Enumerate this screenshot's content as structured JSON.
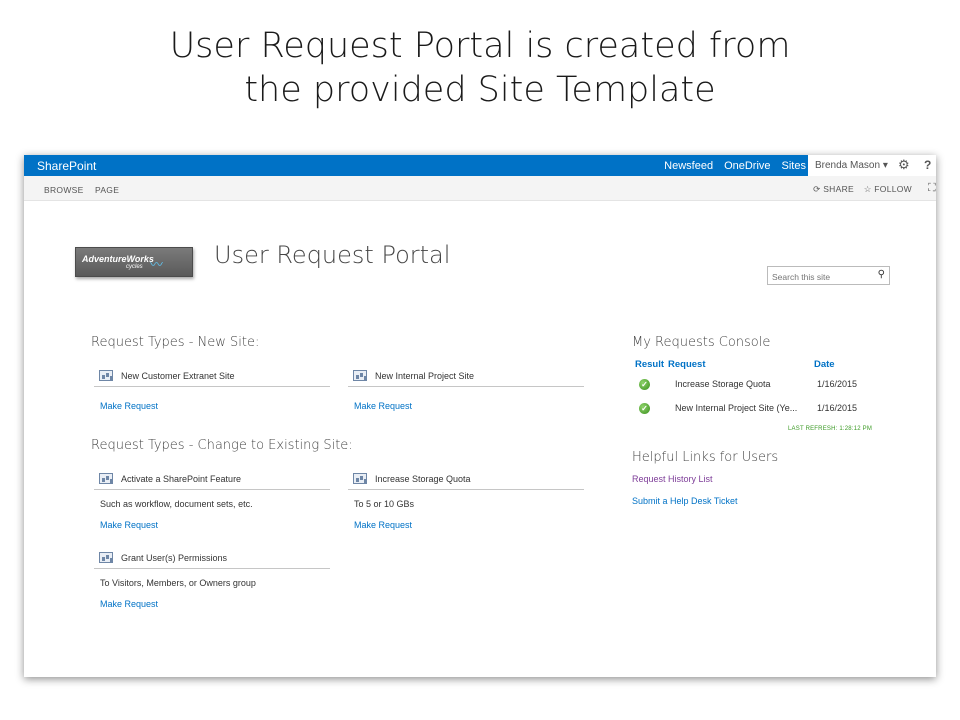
{
  "slide": {
    "title_line1": "User Request Portal is created from",
    "title_line2": "the provided Site Template"
  },
  "suitebar": {
    "brand": "SharePoint",
    "links": [
      "Newsfeed",
      "OneDrive",
      "Sites"
    ],
    "user": "Brenda Mason ▾",
    "gear_icon": "gear-icon",
    "help_label": "?"
  },
  "ribbon": {
    "tabs": [
      "BROWSE",
      "PAGE"
    ],
    "share": "SHARE",
    "follow": "FOLLOW"
  },
  "site": {
    "logo_text": "AdventureWorks",
    "logo_sub": "cycles",
    "title": "User Request Portal",
    "search_placeholder": "Search this site"
  },
  "new_site": {
    "heading": "Request Types - New Site:",
    "cards": [
      {
        "label": "New Customer Extranet Site",
        "link": "Make Request"
      },
      {
        "label": "New Internal Project Site",
        "link": "Make Request"
      }
    ]
  },
  "change_site": {
    "heading": "Request Types - Change to Existing Site:",
    "cards": [
      {
        "label": "Activate a SharePoint Feature",
        "desc": "Such as workflow, document sets, etc.",
        "link": "Make Request"
      },
      {
        "label": "Increase Storage Quota",
        "desc": "To 5 or 10 GBs",
        "link": "Make Request"
      },
      {
        "label": "Grant User(s) Permissions",
        "desc": "To Visitors, Members, or Owners group",
        "link": "Make Request"
      }
    ]
  },
  "console": {
    "heading": "My Requests Console",
    "columns": {
      "result": "Result",
      "request": "Request",
      "date": "Date"
    },
    "rows": [
      {
        "request": "Increase Storage Quota",
        "date": "1/16/2015"
      },
      {
        "request": "New Internal Project Site (Ye...",
        "date": "1/16/2015"
      }
    ],
    "last_refresh": "LAST REFRESH: 1:28:12 PM"
  },
  "helpful": {
    "heading": "Helpful Links for Users",
    "links": [
      "Request History List",
      "Submit a Help Desk Ticket"
    ]
  },
  "colors": {
    "suitebar": "#0072c6",
    "link": "#0072c6",
    "visited_link": "#7d3c98",
    "refresh": "#3b9a24"
  }
}
